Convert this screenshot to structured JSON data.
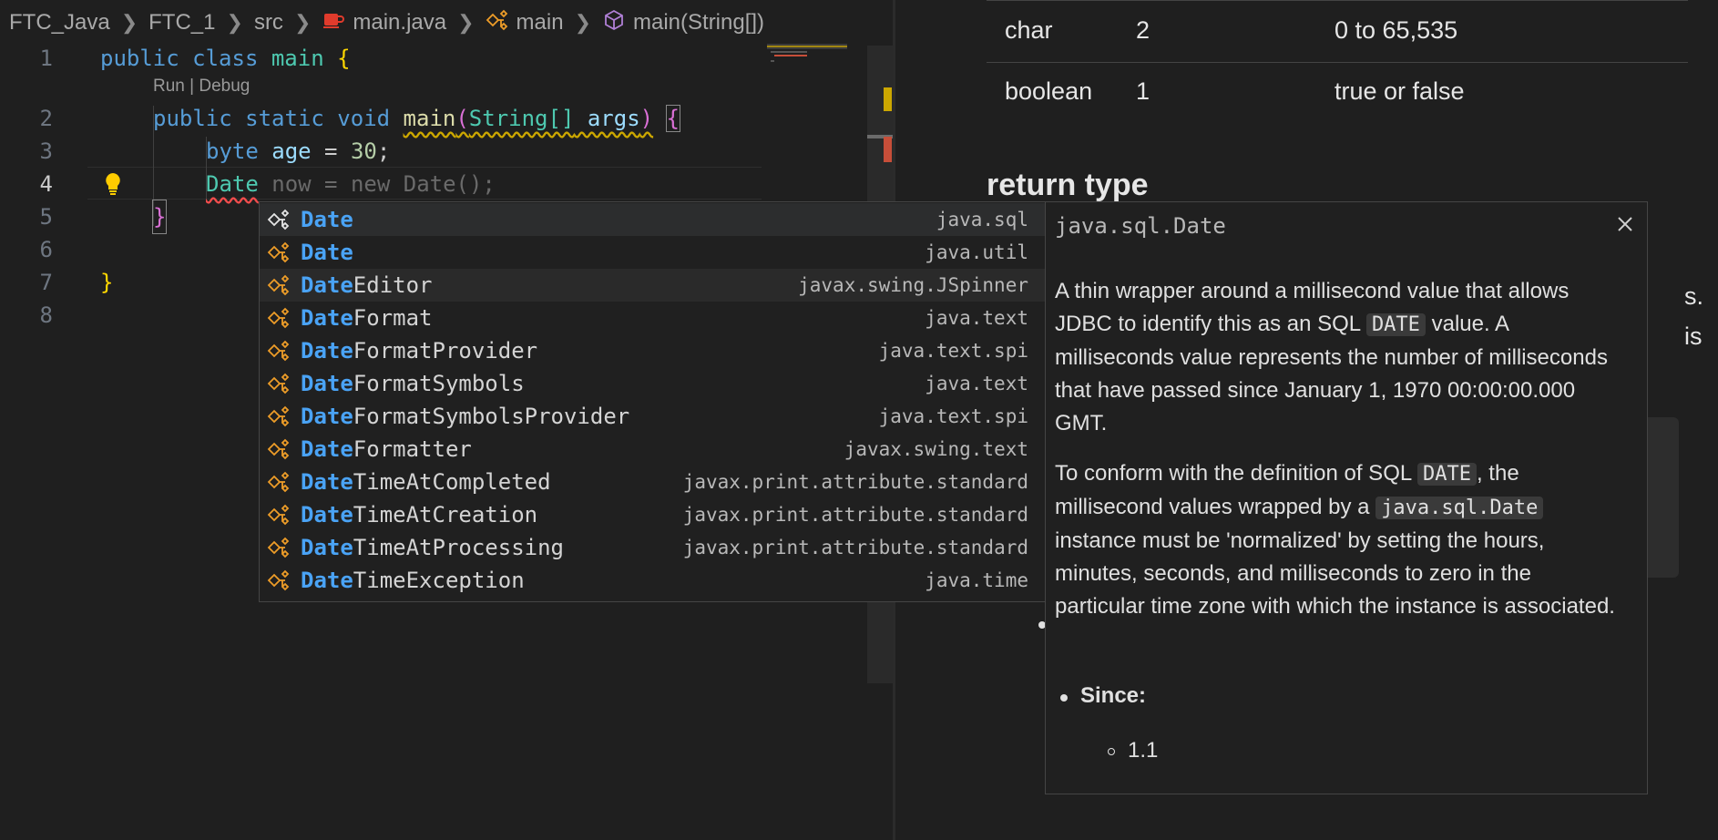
{
  "breadcrumb": [
    {
      "label": "FTC_Java",
      "icon": "none"
    },
    {
      "label": "FTC_1",
      "icon": "none"
    },
    {
      "label": "src",
      "icon": "none"
    },
    {
      "label": "main.java",
      "icon": "java-file-icon"
    },
    {
      "label": "main",
      "icon": "class-icon"
    },
    {
      "label": "main(String[])",
      "icon": "method-cube-icon"
    }
  ],
  "editor": {
    "line_numbers": [
      "1",
      "2",
      "3",
      "4",
      "5",
      "6",
      "7",
      "8"
    ],
    "active_line": "4",
    "codelens": "Run | Debug",
    "code": {
      "l1": {
        "kw": "public class",
        "name": " main ",
        "brace": "{"
      },
      "l2": {
        "kw": "public static void",
        "fn": "main",
        "paren_open": "(",
        "type": "String[]",
        "arg": " args",
        "paren_close": ")",
        "brace": "{"
      },
      "l3": {
        "kw": "byte",
        "var": " age",
        "op": " = ",
        "num": "30",
        "end": ";"
      },
      "l4": {
        "typed": "Date",
        "ghost": " now = new Date();"
      },
      "l5": {
        "brace": "}"
      },
      "l7": {
        "brace": "}"
      }
    },
    "lightbulb_icon": "lightbulb-icon"
  },
  "suggestions": [
    {
      "match": "Date",
      "rest": "",
      "detail": "java.sql",
      "icon": "class-icon",
      "state": "focused"
    },
    {
      "match": "Date",
      "rest": "",
      "detail": "java.util",
      "icon": "class-icon",
      "state": ""
    },
    {
      "match": "Date",
      "rest": "Editor",
      "detail": "javax.swing.JSpinner",
      "icon": "class-icon",
      "state": "hover"
    },
    {
      "match": "Date",
      "rest": "Format",
      "detail": "java.text",
      "icon": "class-icon",
      "state": ""
    },
    {
      "match": "Date",
      "rest": "FormatProvider",
      "detail": "java.text.spi",
      "icon": "class-icon",
      "state": ""
    },
    {
      "match": "Date",
      "rest": "FormatSymbols",
      "detail": "java.text",
      "icon": "class-icon",
      "state": ""
    },
    {
      "match": "Date",
      "rest": "FormatSymbolsProvider",
      "detail": "java.text.spi",
      "icon": "class-icon",
      "state": ""
    },
    {
      "match": "Date",
      "rest": "Formatter",
      "detail": "javax.swing.text",
      "icon": "class-icon",
      "state": ""
    },
    {
      "match": "Date",
      "rest": "TimeAtCompleted",
      "detail": "javax.print.attribute.standard",
      "icon": "class-icon",
      "state": ""
    },
    {
      "match": "Date",
      "rest": "TimeAtCreation",
      "detail": "javax.print.attribute.standard",
      "icon": "class-icon",
      "state": ""
    },
    {
      "match": "Date",
      "rest": "TimeAtProcessing",
      "detail": "javax.print.attribute.standard",
      "icon": "class-icon",
      "state": ""
    },
    {
      "match": "Date",
      "rest": "TimeException",
      "detail": "java.time",
      "icon": "class-icon",
      "state": ""
    }
  ],
  "details": {
    "title": "java.sql.Date",
    "close_icon": "close-icon",
    "p1_a": "A thin wrapper around a millisecond value that allows JDBC to identify this as an SQL ",
    "p1_code": "DATE",
    "p1_b": " value. A milliseconds value represents the number of milliseconds that have passed since January 1, 1970 00:00:00.000 GMT.",
    "p2_a": "To conform with the definition of SQL ",
    "p2_code1": "DATE",
    "p2_b": ", the millisecond values wrapped by a ",
    "p2_code2": "java.sql.Date",
    "p2_c": " instance must be 'normalized' by setting the hours, minutes, seconds, and milliseconds to zero in the particular time zone with which the instance is associated.",
    "since_label": "Since:",
    "since_value": "1.1"
  },
  "doc_pane": {
    "table_rows": [
      {
        "type": "char",
        "size": "2",
        "range": "0 to 65,535"
      },
      {
        "type": "boolean",
        "size": "1",
        "range": "true or false"
      }
    ],
    "heading": "return type",
    "frag1": "s.",
    "frag2": "is"
  },
  "colors": {
    "background": "#1f1f1f",
    "keyword": "#569cd6",
    "match_highlight": "#4aa3f5",
    "class_icon": "#ee9d28",
    "warning_squiggle": "#cca700",
    "error_squiggle": "#f14c4c"
  }
}
